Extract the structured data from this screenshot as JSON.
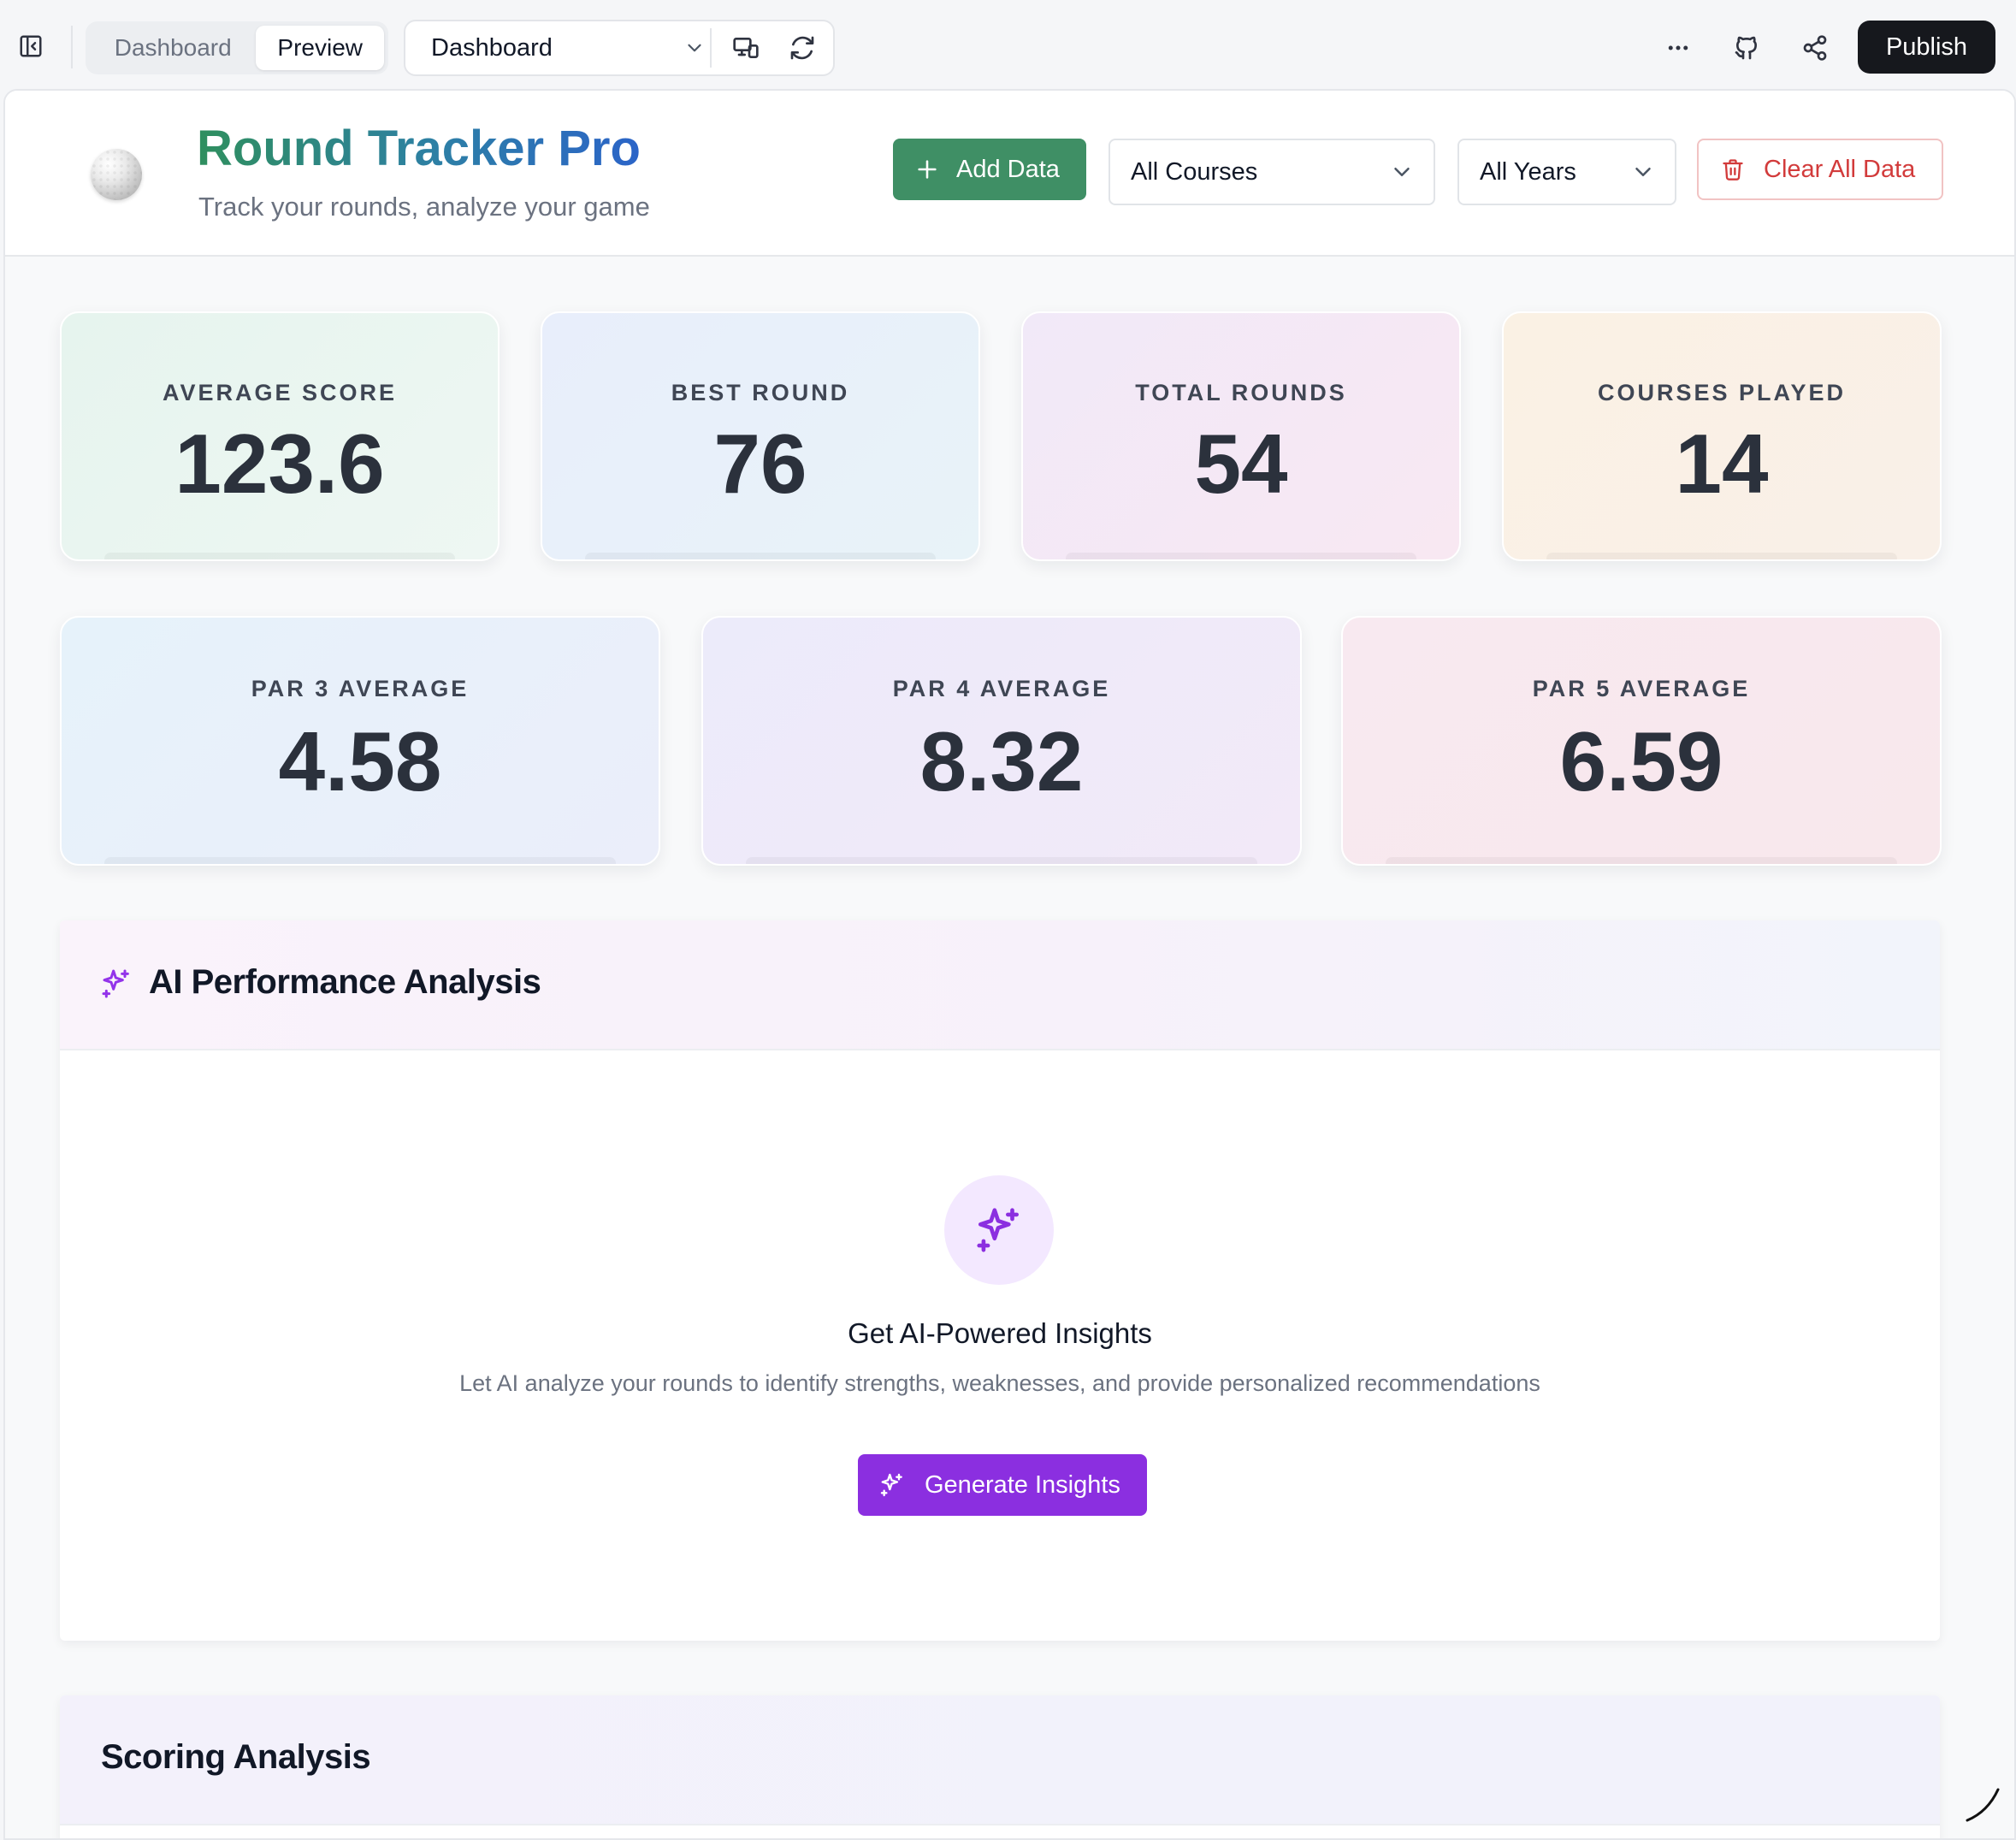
{
  "toolbar": {
    "tabs": [
      {
        "label": "Dashboard",
        "active": false
      },
      {
        "label": "Preview",
        "active": true
      }
    ],
    "page_select": {
      "value": "Dashboard"
    },
    "publish_label": "Publish",
    "icons": [
      "sidebar-toggle-icon",
      "devices-icon",
      "refresh-icon",
      "more-icon",
      "github-icon",
      "share-icon"
    ]
  },
  "header": {
    "title": "Round Tracker Pro",
    "subtitle": "Track your rounds, analyze your game",
    "add_label": "Add Data",
    "course_filter": "All Courses",
    "year_filter": "All Years",
    "clear_label": "Clear All Data"
  },
  "stats": [
    {
      "label": "AVERAGE SCORE",
      "value": "123.6"
    },
    {
      "label": "BEST ROUND",
      "value": "76"
    },
    {
      "label": "TOTAL ROUNDS",
      "value": "54"
    },
    {
      "label": "COURSES PLAYED",
      "value": "14"
    }
  ],
  "par_stats": [
    {
      "label": "PAR 3 AVERAGE",
      "value": "4.58"
    },
    {
      "label": "PAR 4 AVERAGE",
      "value": "8.32"
    },
    {
      "label": "PAR 5 AVERAGE",
      "value": "6.59"
    }
  ],
  "ai": {
    "title": "AI Performance Analysis",
    "empty_title": "Get AI-Powered Insights",
    "empty_desc": "Let AI analyze your rounds to identify strengths, weaknesses, and provide personalized recommendations",
    "button_label": "Generate Insights"
  },
  "scoring": {
    "title": "Scoring Analysis"
  },
  "colors": {
    "primary_green": "#3f8f65",
    "danger": "#d23b3b",
    "ai_purple": "#8b2fe0",
    "publish": "#16181d"
  }
}
